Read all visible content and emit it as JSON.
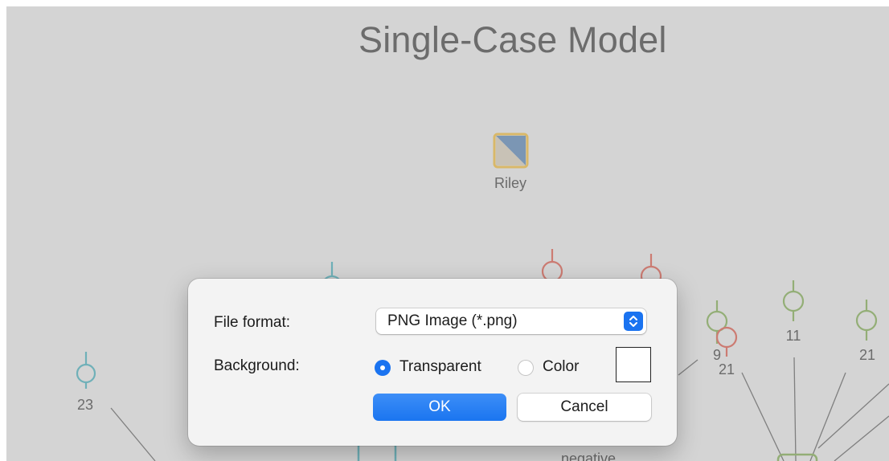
{
  "canvas": {
    "title": "Single-Case Model",
    "case_node_label": "Riley",
    "node_labels": [
      "23",
      "9",
      "21",
      "11",
      "21"
    ],
    "partial_label": "negative"
  },
  "dialog": {
    "file_format_label": "File format:",
    "file_format_value": "PNG Image (*.png)",
    "background_label": "Background:",
    "transparent_label": "Transparent",
    "color_label": "Color",
    "transparent_selected": true,
    "swatch_color": "#ffffff",
    "ok_label": "OK",
    "cancel_label": "Cancel"
  },
  "colors": {
    "accent": "#1a73f0",
    "teal_node": "#6fb0b8",
    "red_node": "#cc7b72",
    "green_node": "#93ae76",
    "case_node_border": "#d9b869",
    "case_node_fill": "#7b96b4"
  }
}
